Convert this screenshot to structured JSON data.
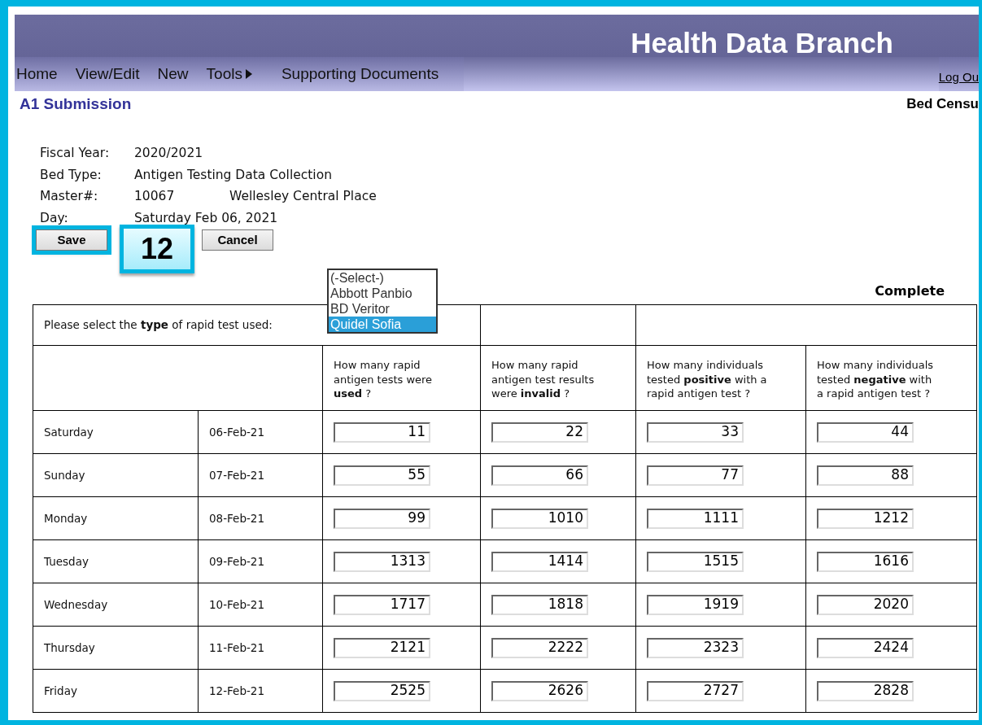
{
  "header": {
    "title": "Health Data Branch"
  },
  "menu": [
    {
      "label": "Home",
      "has_submenu": false
    },
    {
      "label": "View/Edit",
      "has_submenu": false
    },
    {
      "label": "New",
      "has_submenu": false
    },
    {
      "label": "Tools",
      "has_submenu": true
    },
    {
      "label": "Supporting Documents",
      "has_submenu": false
    }
  ],
  "logout": "Log Ou",
  "page_title": "A1 Submission",
  "section_title": "Bed Censu",
  "info": [
    {
      "label": "Fiscal Year:",
      "value": "2020/2021"
    },
    {
      "label": "Bed Type:",
      "value": "Antigen Testing Data Collection"
    },
    {
      "label": "Master#:",
      "value": "10067",
      "extra": "Wellesley Central Place"
    },
    {
      "label": "Day:",
      "value": "Saturday Feb 06, 2021"
    }
  ],
  "buttons": [
    {
      "label": "Save",
      "highlighted": true
    },
    {
      "label": "Cancel",
      "highlighted": false
    }
  ],
  "callout": "12",
  "status": "Complete",
  "test_type": {
    "prompt": "Please select the **type** of rapid test used:",
    "options": [
      {
        "label": "(-Select-)",
        "selected": false
      },
      {
        "label": "Abbott Panbio",
        "selected": false
      },
      {
        "label": "BD Veritor",
        "selected": false
      },
      {
        "label": "Quidel Sofia",
        "selected": true
      }
    ]
  },
  "columns": [
    "How many rapid antigen tests were **used** ?",
    "How many rapid antigen test results were **invalid** ?",
    "How many individuals tested **positive** with a rapid antigen test ?",
    "How many individuals tested **negative** with a rapid antigen test ?"
  ],
  "rows": [
    {
      "day": "Saturday",
      "date": "06-Feb-21",
      "values": [
        "11",
        "22",
        "33",
        "44"
      ]
    },
    {
      "day": "Sunday",
      "date": "07-Feb-21",
      "values": [
        "55",
        "66",
        "77",
        "88"
      ]
    },
    {
      "day": "Monday",
      "date": "08-Feb-21",
      "values": [
        "99",
        "1010",
        "1111",
        "1212"
      ]
    },
    {
      "day": "Tuesday",
      "date": "09-Feb-21",
      "values": [
        "1313",
        "1414",
        "1515",
        "1616"
      ]
    },
    {
      "day": "Wednesday",
      "date": "10-Feb-21",
      "values": [
        "1717",
        "1818",
        "1919",
        "2020"
      ]
    },
    {
      "day": "Thursday",
      "date": "11-Feb-21",
      "values": [
        "2121",
        "2222",
        "2323",
        "2424"
      ]
    },
    {
      "day": "Friday",
      "date": "12-Feb-21",
      "values": [
        "2525",
        "2626",
        "2727",
        "2828"
      ]
    }
  ]
}
